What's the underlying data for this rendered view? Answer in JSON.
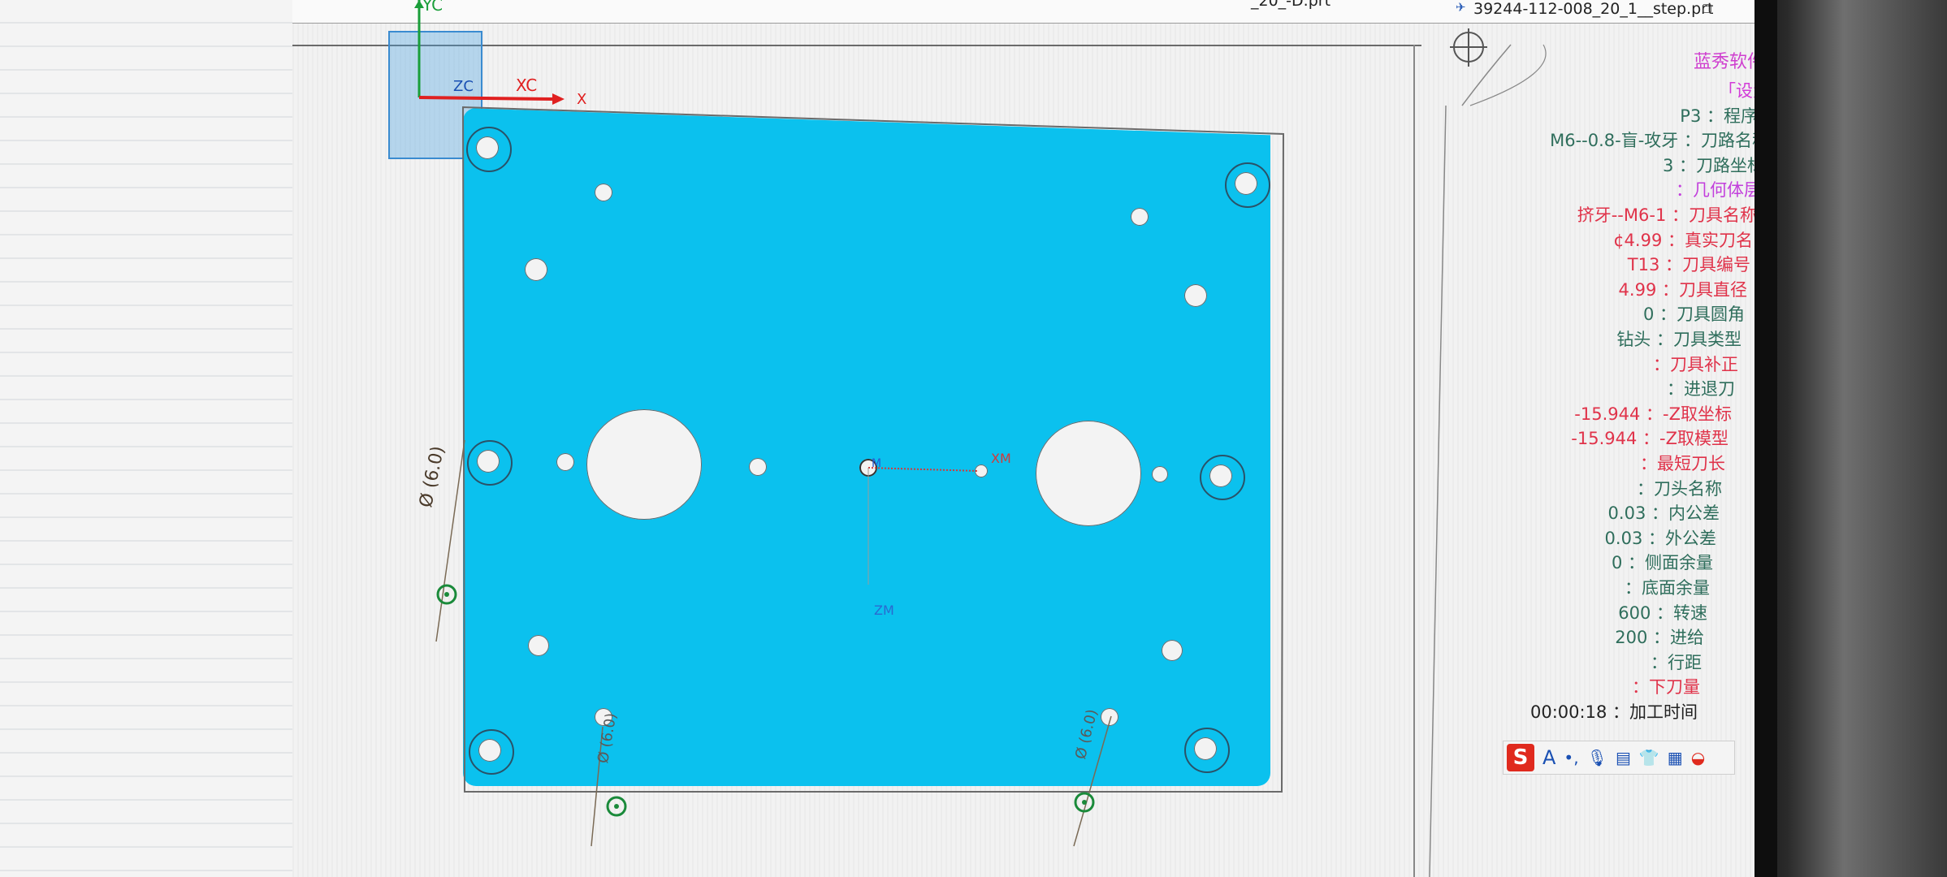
{
  "titlebar": {
    "tab1_text": "_20_-D.prt",
    "tab2_text": "39244-112-008_20_1__step.prt"
  },
  "axes": {
    "yc": "YC",
    "zc": "ZC",
    "xc": "XC",
    "x": "X",
    "xm": "XM",
    "zm": "ZM",
    "model_origin": "M"
  },
  "dims": {
    "left": "Ø (6.0)",
    "bottom_left": "Ø (6.0)",
    "bottom_right": "Ø (6.0)"
  },
  "watermark": "蓝秀软件  ·  免费使用",
  "info_panel": [
    {
      "value": "",
      "label": "「设置」",
      "color": "#d23bd8"
    },
    {
      "value": "P3",
      "label": "程序组",
      "color": "#2f6e5c"
    },
    {
      "value": "M6--0.8-盲-攻牙",
      "label": "刀路名称",
      "color": "#2f6e5c"
    },
    {
      "value": "3",
      "label": "刀路坐标",
      "color": "#2f6e5c"
    },
    {
      "value": "",
      "label": "几何体层",
      "color": "#c23fdc"
    },
    {
      "value": "挤牙--M6-1",
      "label": "刀具名称",
      "color": "#e0334a"
    },
    {
      "value": "¢4.99",
      "label": "真实刀名",
      "color": "#e0334a"
    },
    {
      "value": "T13",
      "label": "刀具编号",
      "color": "#e0334a"
    },
    {
      "value": "4.99",
      "label": "刀具直径",
      "color": "#e0334a"
    },
    {
      "value": "0",
      "label": "刀具圆角",
      "color": "#2f6e5c"
    },
    {
      "value": "钻头",
      "label": "刀具类型",
      "color": "#2f6e5c"
    },
    {
      "value": "",
      "label": "刀具补正",
      "color": "#e0334a"
    },
    {
      "value": "",
      "label": "进退刀",
      "color": "#2f6e5c"
    },
    {
      "value": "-15.944",
      "label": "-Z取坐标",
      "color": "#e0334a"
    },
    {
      "value": "-15.944",
      "label": "-Z取模型",
      "color": "#e0334a"
    },
    {
      "value": "",
      "label": "最短刀长",
      "color": "#e0334a"
    },
    {
      "value": "",
      "label": "刀头名称",
      "color": "#2f6e5c"
    },
    {
      "value": "0.03",
      "label": "内公差",
      "color": "#2f6e5c"
    },
    {
      "value": "0.03",
      "label": "外公差",
      "color": "#2f6e5c"
    },
    {
      "value": "0",
      "label": "侧面余量",
      "color": "#2f6e5c"
    },
    {
      "value": "",
      "label": "底面余量",
      "color": "#2f6e5c"
    },
    {
      "value": "600",
      "label": "转速",
      "color": "#2f6e5c"
    },
    {
      "value": "200",
      "label": "进给",
      "color": "#2f6e5c"
    },
    {
      "value": "",
      "label": "行距",
      "color": "#2f6e5c"
    },
    {
      "value": "",
      "label": "下刀量",
      "color": "#e0334a"
    },
    {
      "value": "00:00:18",
      "label": "加工时间",
      "color": "#222222"
    }
  ],
  "ime": {
    "logo": "S",
    "mode": "A"
  },
  "colors": {
    "part": "#0bc1ee",
    "wcs_y": "#1a9e3a",
    "wcs_x": "#e02020"
  }
}
